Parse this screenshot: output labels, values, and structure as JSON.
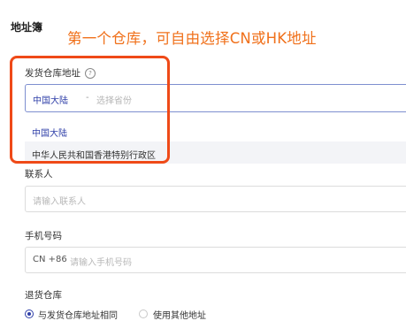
{
  "page": {
    "title": "地址簿",
    "annotation": "第一个仓库，可自由选择CN或HK地址"
  },
  "warehouse": {
    "label": "发货仓库地址",
    "help_icon": "question-circle-icon",
    "help_glyph": "?",
    "selected": "中国大陆",
    "separator": "-",
    "province_placeholder": "选择省份",
    "options": [
      "中国大陆",
      "中华人民共和国香港特别行政区"
    ]
  },
  "contact": {
    "label": "联系人",
    "placeholder": "请输入联系人"
  },
  "phone": {
    "label": "手机号码",
    "prefix": "CN +86",
    "placeholder": "请输入手机号码"
  },
  "return_warehouse": {
    "label": "退货仓库",
    "options": [
      "与发货仓库地址相同",
      "使用其他地址"
    ],
    "selected_index": 0
  },
  "colors": {
    "annotation": "#f0701a",
    "highlight_border": "#ef4a18",
    "accent": "#2f3fa8"
  }
}
